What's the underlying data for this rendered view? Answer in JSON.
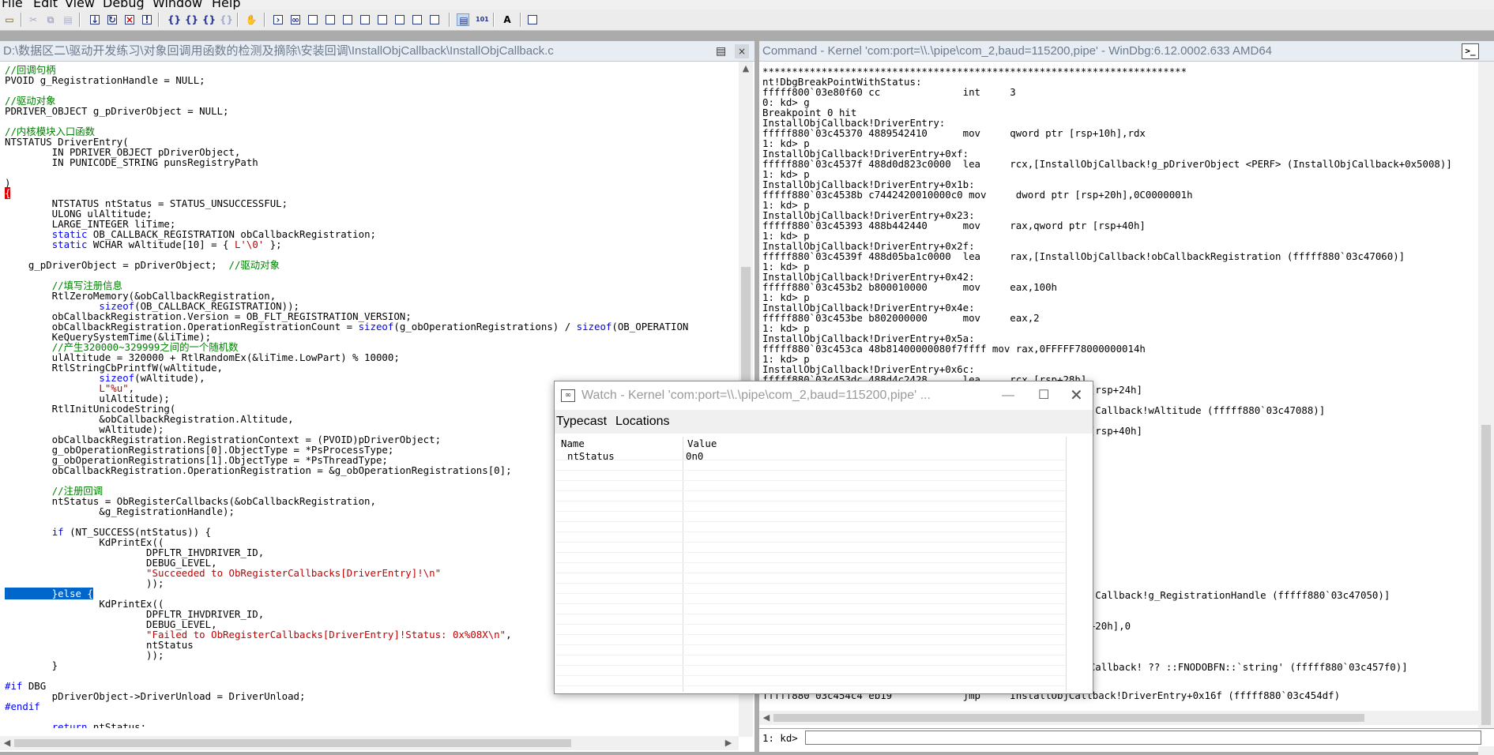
{
  "menu": [
    "File",
    "Edit",
    "View",
    "Debug",
    "Window",
    "Help"
  ],
  "source_pane": {
    "title": "D:\\数据区二\\驱动开发练习\\对象回调用函数的检测及摘除\\安装回调\\InstallObjCallback\\InstallObjCallback.c",
    "lines": [
      [
        [
          "cm",
          "//回调句柄"
        ]
      ],
      [
        [
          "",
          "PVOID g_RegistrationHandle = NULL;"
        ]
      ],
      [
        [
          "",
          ""
        ]
      ],
      [
        [
          "cm",
          "//驱动对象"
        ]
      ],
      [
        [
          "",
          "PDRIVER_OBJECT g_pDriverObject = NULL;"
        ]
      ],
      [
        [
          "",
          ""
        ]
      ],
      [
        [
          "cm",
          "//内核模块入口函数"
        ]
      ],
      [
        [
          "",
          "NTSTATUS DriverEntry("
        ]
      ],
      [
        [
          "",
          "        IN PDRIVER_OBJECT pDriverObject,"
        ]
      ],
      [
        [
          "",
          "        IN PUNICODE_STRING punsRegistryPath"
        ]
      ],
      [
        [
          "",
          ""
        ]
      ],
      [
        [
          "",
          ")"
        ]
      ],
      [
        [
          "bp",
          "{"
        ]
      ],
      [
        [
          "",
          "        NTSTATUS ntStatus = STATUS_UNSUCCESSFUL;"
        ]
      ],
      [
        [
          "",
          "        ULONG ulAltitude;"
        ]
      ],
      [
        [
          "",
          "        LARGE_INTEGER liTime;"
        ]
      ],
      [
        [
          "",
          "        "
        ],
        [
          "kw",
          "static"
        ],
        [
          "",
          " OB_CALLBACK_REGISTRATION obCallbackRegistration;"
        ]
      ],
      [
        [
          "",
          "        "
        ],
        [
          "kw",
          "static"
        ],
        [
          "",
          " WCHAR wAltitude[10] = { "
        ],
        [
          "str",
          "L'\\0'"
        ],
        [
          "",
          " };"
        ]
      ],
      [
        [
          "",
          ""
        ]
      ],
      [
        [
          "",
          "    g_pDriverObject = pDriverObject;  "
        ],
        [
          "cm",
          "//驱动对象"
        ]
      ],
      [
        [
          "",
          ""
        ]
      ],
      [
        [
          "",
          "        "
        ],
        [
          "cm",
          "//填写注册信息"
        ]
      ],
      [
        [
          "",
          "        RtlZeroMemory(&obCallbackRegistration,"
        ]
      ],
      [
        [
          "",
          "                "
        ],
        [
          "kw",
          "sizeof"
        ],
        [
          "",
          "(OB_CALLBACK_REGISTRATION));"
        ]
      ],
      [
        [
          "",
          "        obCallbackRegistration.Version = OB_FLT_REGISTRATION_VERSION;"
        ]
      ],
      [
        [
          "",
          "        obCallbackRegistration.OperationRegistrationCount = "
        ],
        [
          "kw",
          "sizeof"
        ],
        [
          "",
          "(g_obOperationRegistrations) / "
        ],
        [
          "kw",
          "sizeof"
        ],
        [
          "",
          "(OB_OPERATION"
        ]
      ],
      [
        [
          "",
          "        KeQuerySystemTime(&liTime);"
        ]
      ],
      [
        [
          "",
          "        "
        ],
        [
          "cm",
          "//产生320000~329999之间的一个随机数"
        ]
      ],
      [
        [
          "",
          "        ulAltitude = 320000 + RtlRandomEx(&liTime.LowPart) % 10000;"
        ]
      ],
      [
        [
          "",
          "        RtlStringCbPrintfW(wAltitude,"
        ]
      ],
      [
        [
          "",
          "                "
        ],
        [
          "kw",
          "sizeof"
        ],
        [
          "",
          "(wAltitude),"
        ]
      ],
      [
        [
          "",
          "                "
        ],
        [
          "str",
          "L\"%u\""
        ],
        [
          "",
          ","
        ]
      ],
      [
        [
          "",
          "                ulAltitude);"
        ]
      ],
      [
        [
          "",
          "        RtlInitUnicodeString("
        ]
      ],
      [
        [
          "",
          "                &obCallbackRegistration.Altitude,"
        ]
      ],
      [
        [
          "",
          "                wAltitude);"
        ]
      ],
      [
        [
          "",
          "        obCallbackRegistration.RegistrationContext = (PVOID)pDriverObject;"
        ]
      ],
      [
        [
          "",
          "        g_obOperationRegistrations[0].ObjectType = *PsProcessType;"
        ]
      ],
      [
        [
          "",
          "        g_obOperationRegistrations[1].ObjectType = *PsThreadType;"
        ]
      ],
      [
        [
          "",
          "        obCallbackRegistration.OperationRegistration = &g_obOperationRegistrations[0];"
        ]
      ],
      [
        [
          "",
          ""
        ]
      ],
      [
        [
          "",
          "        "
        ],
        [
          "cm",
          "//注册回调"
        ]
      ],
      [
        [
          "",
          "        ntStatus = ObRegisterCallbacks(&obCallbackRegistration,"
        ]
      ],
      [
        [
          "",
          "                &g_RegistrationHandle);"
        ]
      ],
      [
        [
          "",
          ""
        ]
      ],
      [
        [
          "",
          "        "
        ],
        [
          "kw",
          "if"
        ],
        [
          "",
          " (NT_SUCCESS(ntStatus)) {"
        ]
      ],
      [
        [
          "",
          "                KdPrintEx(("
        ]
      ],
      [
        [
          "",
          "                        DPFLTR_IHVDRIVER_ID,"
        ]
      ],
      [
        [
          "",
          "                        DEBUG_LEVEL,"
        ]
      ],
      [
        [
          "",
          "                        "
        ],
        [
          "str",
          "\"Succeeded to ObRegisterCallbacks[DriverEntry]!\\n\""
        ]
      ],
      [
        [
          "",
          "                        ));"
        ]
      ],
      [
        [
          "sel",
          "        }else {"
        ]
      ],
      [
        [
          "",
          "                KdPrintEx(("
        ]
      ],
      [
        [
          "",
          "                        DPFLTR_IHVDRIVER_ID,"
        ]
      ],
      [
        [
          "",
          "                        DEBUG_LEVEL,"
        ]
      ],
      [
        [
          "",
          "                        "
        ],
        [
          "str",
          "\"Failed to ObRegisterCallbacks[DriverEntry]!Status: 0x%08X\\n\""
        ],
        [
          "",
          ","
        ]
      ],
      [
        [
          "",
          "                        ntStatus"
        ]
      ],
      [
        [
          "",
          "                        ));"
        ]
      ],
      [
        [
          "",
          "        }"
        ]
      ],
      [
        [
          "",
          ""
        ]
      ],
      [
        [
          "kw",
          "#if"
        ],
        [
          "",
          " DBG"
        ]
      ],
      [
        [
          "",
          "        pDriverObject->DriverUnload = DriverUnload;"
        ]
      ],
      [
        [
          "kw",
          "#endif"
        ]
      ],
      [
        [
          "",
          ""
        ]
      ],
      [
        [
          "",
          "        "
        ],
        [
          "kw",
          "return"
        ],
        [
          "",
          " ntStatus;"
        ]
      ],
      [
        [
          "",
          "}"
        ]
      ]
    ]
  },
  "command_pane": {
    "title": "Command - Kernel 'com:port=\\\\.\\pipe\\com_2,baud=115200,pipe' - WinDbg:6.12.0002.633 AMD64",
    "lines": [
      "************************************************************************",
      "nt!DbgBreakPointWithStatus:",
      "fffff800`03e80f60 cc              int     3",
      "0: kd> g",
      "Breakpoint 0 hit",
      "InstallObjCallback!DriverEntry:",
      "fffff880`03c45370 4889542410      mov     qword ptr [rsp+10h],rdx",
      "1: kd> p",
      "InstallObjCallback!DriverEntry+0xf:",
      "fffff880`03c4537f 488d0d823c0000  lea     rcx,[InstallObjCallback!g_pDriverObject <PERF> (InstallObjCallback+0x5008)]",
      "1: kd> p",
      "InstallObjCallback!DriverEntry+0x1b:",
      "fffff880`03c4538b c7442420010000c0 mov     dword ptr [rsp+20h],0C0000001h",
      "1: kd> p",
      "InstallObjCallback!DriverEntry+0x23:",
      "fffff880`03c45393 488b442440      mov     rax,qword ptr [rsp+40h]",
      "1: kd> p",
      "InstallObjCallback!DriverEntry+0x2f:",
      "fffff880`03c4539f 488d05ba1c0000  lea     rax,[InstallObjCallback!obCallbackRegistration (fffff880`03c47060)]",
      "1: kd> p",
      "InstallObjCallback!DriverEntry+0x42:",
      "fffff880`03c453b2 b800010000      mov     eax,100h",
      "1: kd> p",
      "InstallObjCallback!DriverEntry+0x4e:",
      "fffff880`03c453be b802000000      mov     eax,2",
      "1: kd> p",
      "InstallObjCallback!DriverEntry+0x5a:",
      "fffff880`03c453ca 48b81400000080f7ffff mov rax,0FFFFF78000000014h",
      "1: kd> p",
      "InstallObjCallback!DriverEntry+0x6c:",
      "fffff880`03c453dc 488d4c2428      lea     rcx,[rsp+28h]"
    ],
    "hidden_tail_lines": [
      "ptr [rsp+24h]",
      "",
      "llObjCallback!wAltitude (fffff880`03c47088)]",
      "",
      "ptr [rsp+40h]",
      "",
      "",
      "",
      "",
      "",
      "",
      "",
      "",
      "",
      "",
      "",
      "",
      "",
      "",
      "",
      "llObjCallback!g_RegistrationHandle (fffff880`03c47050)]",
      "",
      "",
      "[rsp+20h],0",
      "",
      "",
      "",
      "lObjCallback! ?? ::FNODOBFN::`string' (fffff880`03c457f0)]"
    ],
    "last_line": "fffff880`03c454c4 eb19            jmp     InstallObjCallback!DriverEntry+0x16f (fffff880`03c454df)",
    "prompt": "1: kd>",
    "input_value": ""
  },
  "watch_window": {
    "title": "Watch - Kernel 'com:port=\\\\.\\pipe\\com_2,baud=115200,pipe' ...",
    "tabs": [
      "Typecast",
      "Locations"
    ],
    "columns": [
      "Name",
      "Value"
    ],
    "rows": [
      {
        "name": "ntStatus",
        "value": "0n0"
      }
    ]
  }
}
